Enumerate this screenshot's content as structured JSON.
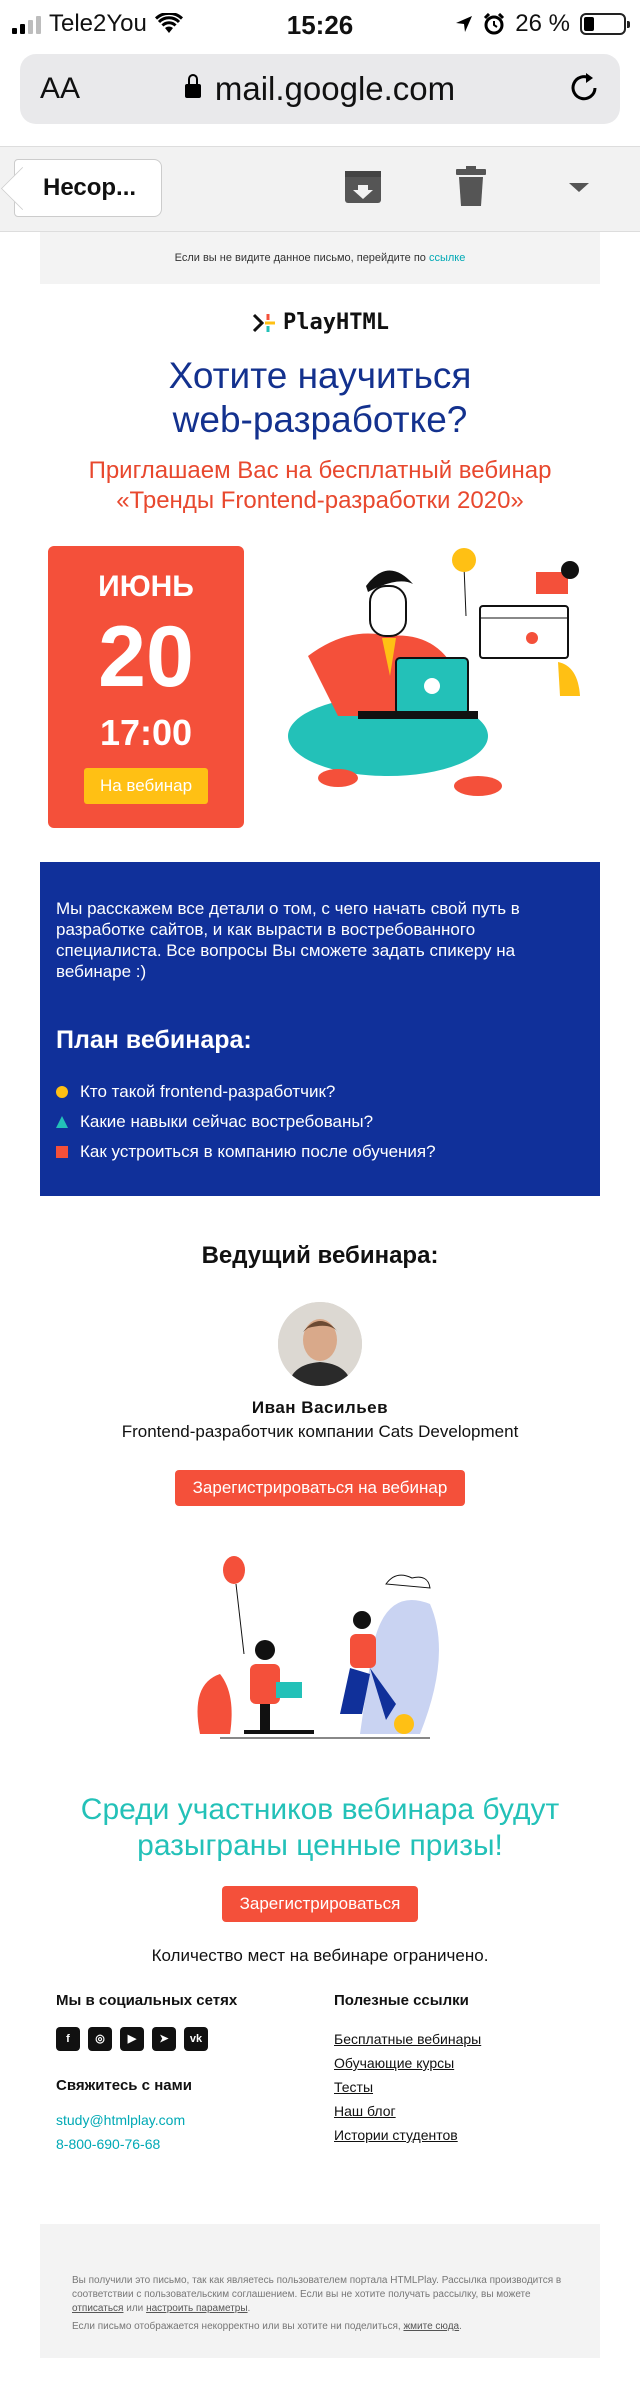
{
  "status_bar": {
    "carrier": "Tele2You",
    "time": "15:26",
    "battery_percent": "26 %"
  },
  "browser": {
    "text_size_label": "AA",
    "url": "mail.google.com"
  },
  "mail_toolbar": {
    "back_label": "Несор..."
  },
  "email": {
    "preheader_text": "Если вы не видите данное письмо, перейдите по",
    "preheader_link": "ссылке",
    "logo_text": "PlayHTML",
    "headline_line1": "Хотите научиться",
    "headline_line2": "web-разработке?",
    "subheadline_line1": "Приглашаем Вас на бесплатный вебинар",
    "subheadline_line2": "«Тренды Frontend-разработки 2020»",
    "date": {
      "month": "ИЮНЬ",
      "day": "20",
      "time": "17:00",
      "button": "На вебинар"
    },
    "intro_text": "Мы расскажем все детали о том, с чего начать свой путь в разработке сайтов, и как вырасти в востребованного специалиста. Все вопросы Вы сможете задать спикеру на вебинаре :)",
    "plan_title": "План вебинара:",
    "plan_items": [
      {
        "text": "Кто такой frontend-разработчик?",
        "marker": "circle",
        "color": "#ffc014"
      },
      {
        "text": "Какие навыки сейчас востребованы?",
        "marker": "triangle",
        "color": "#23c1b8"
      },
      {
        "text": "Как устроиться в компанию после обучения?",
        "marker": "square",
        "color": "#f4503a"
      }
    ],
    "host_title": "Ведущий вебинара:",
    "host_name": "Иван Васильев",
    "host_role": "Frontend-разработчик компании Cats Development",
    "register_button": "Зарегистрироваться на вебинар",
    "prize_line1": "Среди участников вебинара будут",
    "prize_line2": "разыграны ценные призы!",
    "register_button_2": "Зарегистрироваться",
    "limited_text": "Количество мест на вебинаре ограничено.",
    "footer": {
      "social_title": "Мы в социальных сетях",
      "socials": [
        "facebook-icon",
        "instagram-icon",
        "youtube-icon",
        "telegram-icon",
        "vk-icon"
      ],
      "contact_title": "Свяжитесь с нами",
      "email": "study@htmlplay.com",
      "phone": "8-800-690-76-68",
      "links_title": "Полезные ссылки",
      "links": [
        "Бесплатные вебинары",
        "Обучающие курсы",
        "Тесты",
        "Наш блог",
        "Истории студентов"
      ]
    },
    "legal": {
      "line1_a": "Вы получили это письмо, так как являетесь пользователем портала HTMLPlay. Рассылка производится в соответствии с пользовательским соглашением. Если вы не хотите получать рассылку, вы можете",
      "unsubscribe": "отписаться",
      "or": "или",
      "settings": "настроить параметры",
      "line2_a": "Если письмо отображается некорректно или вы хотите ни поделиться,",
      "line2_link": "жмите сюда"
    }
  },
  "colors": {
    "brand_blue": "#13318e",
    "accent_red": "#f4503a",
    "accent_yellow": "#ffc014",
    "accent_teal": "#23c1b8"
  }
}
